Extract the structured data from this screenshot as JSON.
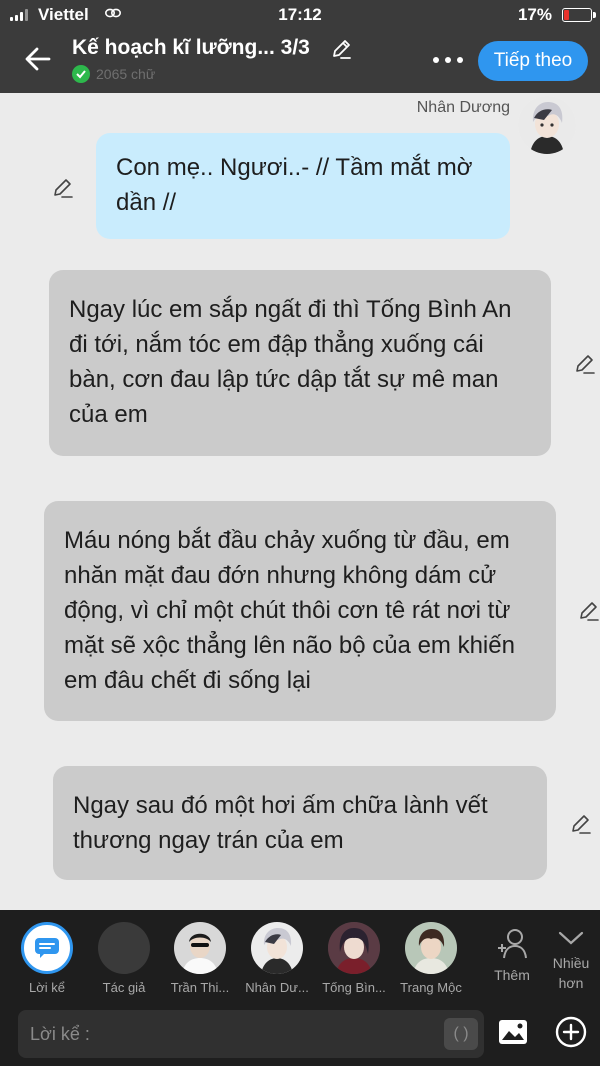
{
  "status_bar": {
    "carrier": "Viettel",
    "time": "17:12",
    "battery": "17%"
  },
  "header": {
    "title": "Kế hoạch kĩ lưỡng... 3/3",
    "word_count": "2065 chữ",
    "next_label": "Tiếp theo"
  },
  "chat": {
    "speaker_name": "Nhân Dương",
    "messages": [
      {
        "text": "Con mẹ.. Ngươi..- // Tầm mắt mờ dần //",
        "style": "blue"
      },
      {
        "text": "Ngay lúc em sắp ngất đi thì Tống Bình An đi tới, nắm tóc em đập thẳng xuống cái bàn, cơn đau lập tức dập tắt sự mê man của em",
        "style": "gray"
      },
      {
        "text": "Máu nóng bắt đầu chảy xuống từ đầu, em nhăn mặt đau đớn nhưng không dám cử động, vì chỉ một chút thôi cơn tê rát nơi từ mặt sẽ xộc thẳng lên não bộ của em khiến em đâu chết đi sống lại",
        "style": "gray"
      },
      {
        "text": "Ngay sau đó một hơi ấm chữa lành vết thương ngay trán của em",
        "style": "gray"
      }
    ]
  },
  "characters": [
    {
      "label": "Lời kể",
      "icon": "narration-icon"
    },
    {
      "label": "Tác giả",
      "icon": "author-avatar"
    },
    {
      "label": "Trần Thi...",
      "icon": "character-avatar"
    },
    {
      "label": "Nhân Dư...",
      "icon": "character-avatar"
    },
    {
      "label": "Tống Bìn...",
      "icon": "character-avatar"
    },
    {
      "label": "Trang Mộc",
      "icon": "character-avatar"
    }
  ],
  "actions": {
    "add_label": "Thêm",
    "more_label_1": "Nhiều",
    "more_label_2": "hơn"
  },
  "composer": {
    "placeholder": "Lời kể :",
    "paren_label": "( )"
  },
  "colors": {
    "accent": "#2f96ef",
    "header_bg": "#3b3b3b",
    "blue_bubble": "#c9ecfd",
    "gray_bubble": "#cbcbcb",
    "bottom_bg": "#1e1e1e"
  }
}
